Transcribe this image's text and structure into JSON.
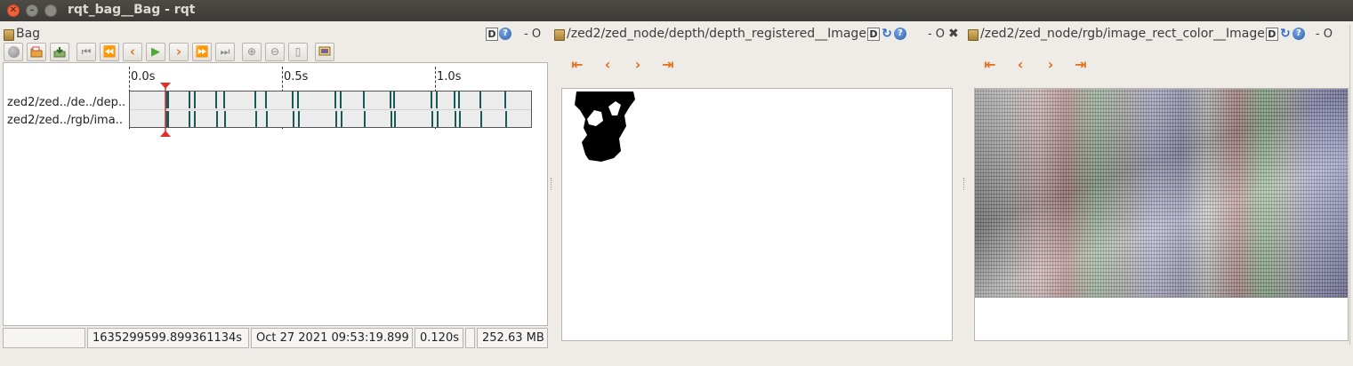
{
  "window": {
    "title": "rqt_bag__Bag - rqt"
  },
  "bag": {
    "title": "Bag",
    "help": "?",
    "dock_ctrl": "- O",
    "timeline": {
      "ticks": [
        "0.0s",
        "0.5s",
        "1.0s"
      ],
      "topics": [
        "zed2/zed../de../dep..",
        "zed2/zed../rgb/ima.."
      ]
    },
    "status": {
      "empty": "",
      "timestamp": "1635299599.899361134s",
      "datetime": "Oct 27 2021 09:53:19.899",
      "elapsed": "0.120s",
      "size": "252.63 MB"
    }
  },
  "depth_panel": {
    "title": "/zed2/zed_node/depth/depth_registered__Image",
    "d": "D",
    "help": "?",
    "dock_ctrl": "- O",
    "close": "✖"
  },
  "rgb_panel": {
    "title": "/zed2/zed_node/rgb/image_rect_color__Image",
    "d": "D",
    "help": "?",
    "dock_ctrl": "- O"
  },
  "colors": {
    "titlebar": "#3c3b37",
    "accent_orange": "#e6721e",
    "marker_teal": "#175a57",
    "playhead_red": "#e0302a"
  }
}
